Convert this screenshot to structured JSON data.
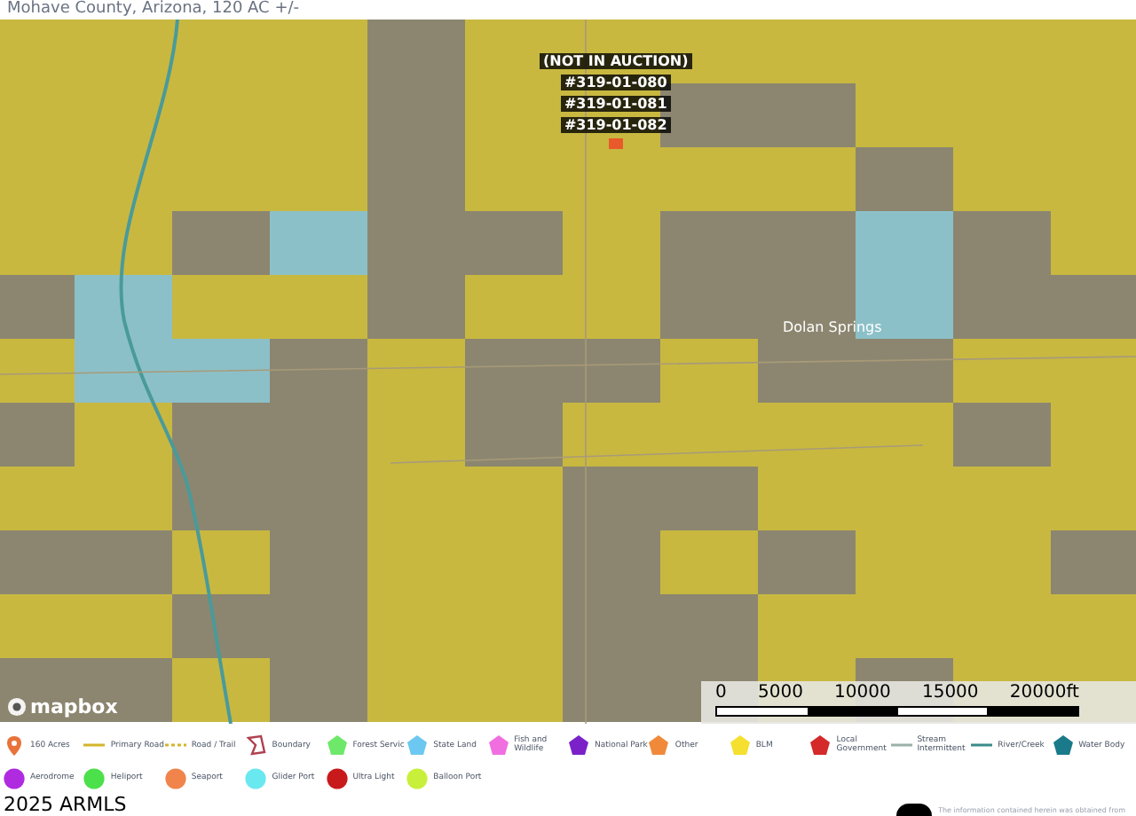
{
  "title": "Mohave County, Arizona, 120 AC +/-",
  "map": {
    "lot_labels": [
      {
        "text": "(NOT IN AUCTION)"
      },
      {
        "text": "#319-01-080"
      },
      {
        "text": "#319-01-081"
      },
      {
        "text": "#319-01-082"
      }
    ],
    "place_label": "Dolan Springs",
    "attribution": "mapbox",
    "scale": {
      "ticks": [
        "0",
        "5000",
        "10000",
        "15000",
        "20000ft"
      ]
    }
  },
  "legend": [
    {
      "kind": "pin",
      "color": "#e8743b",
      "label": "160 Acres"
    },
    {
      "kind": "line",
      "color": "#d4b52a",
      "label": "Primary Road"
    },
    {
      "kind": "dashed",
      "color": "#d4b52a",
      "label": "Road / Trail"
    },
    {
      "kind": "outline",
      "color": "#b04050",
      "label": "Boundary"
    },
    {
      "kind": "polygon",
      "color": "#6ee86a",
      "label": "Forest Servic"
    },
    {
      "kind": "polygon",
      "color": "#6cc8f0",
      "label": "State Land"
    },
    {
      "kind": "polygon",
      "color": "#f06ee0",
      "label": "Fish and Wildlife"
    },
    {
      "kind": "polygon",
      "color": "#7a22c8",
      "label": "National Park"
    },
    {
      "kind": "polygon",
      "color": "#f08a3a",
      "label": "Other"
    },
    {
      "kind": "polygon",
      "color": "#f5e030",
      "label": "BLM"
    },
    {
      "kind": "polygon",
      "color": "#d42a2a",
      "label": "Local Government"
    },
    {
      "kind": "line",
      "color": "#9ab0a8",
      "label": "Stream Intermittent"
    },
    {
      "kind": "line",
      "color": "#3a8a8a",
      "label": "River/Creek"
    },
    {
      "kind": "polygon",
      "color": "#1a7a8a",
      "label": "Water Body"
    },
    {
      "kind": "circle",
      "color": "#b02ae0",
      "label": "Aerodrome"
    },
    {
      "kind": "circle",
      "color": "#4ce04a",
      "label": "Heliport"
    },
    {
      "kind": "circle",
      "color": "#f0844a",
      "label": "Seaport"
    },
    {
      "kind": "circle",
      "color": "#6ae8f0",
      "label": "Glider Port"
    },
    {
      "kind": "circle",
      "color": "#c81a1a",
      "label": "Ultra Light"
    },
    {
      "kind": "circle",
      "color": "#c8f03a",
      "label": "Balloon Port"
    }
  ],
  "footer": {
    "copyright": "2025 ARMLS",
    "disclaimer": "The information contained herein was obtained from"
  }
}
